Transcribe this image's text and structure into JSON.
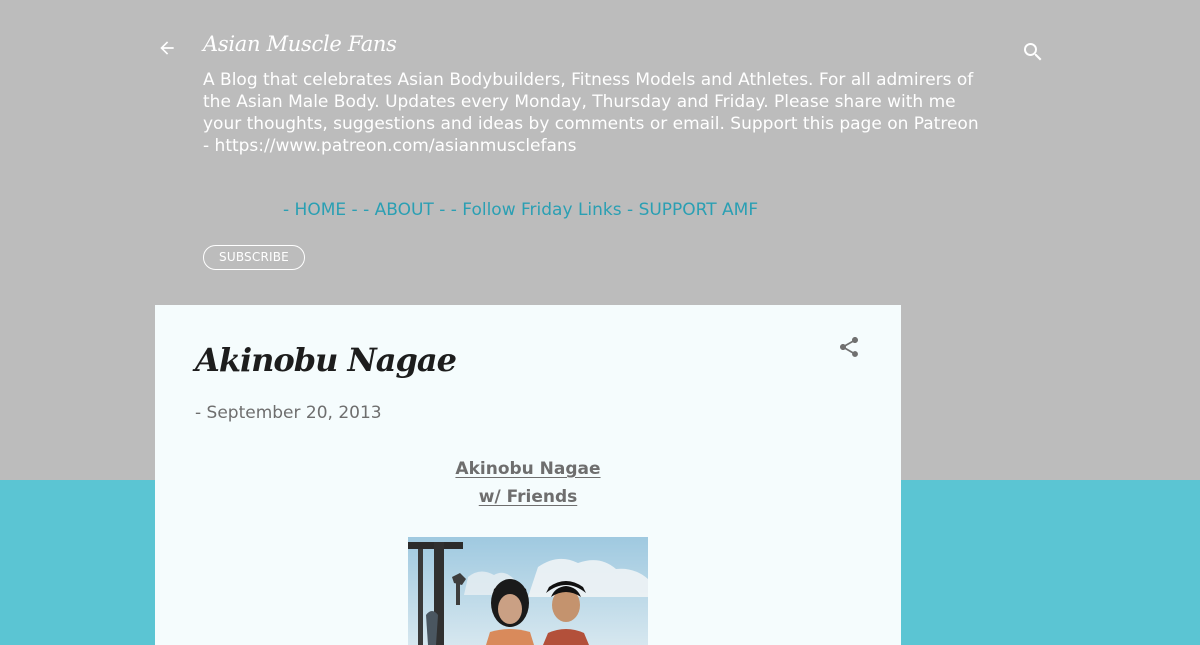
{
  "header": {
    "blog_title": "Asian Muscle Fans",
    "description": "A Blog that celebrates Asian Bodybuilders, Fitness Models and Athletes. For all admirers of the Asian Male Body. Updates every Monday, Thursday and Friday. Please share with me your thoughts, suggestions and ideas by comments or email. Support this page on Patreon - https://www.patreon.com/asianmusclefans",
    "nav": {
      "home": "- HOME -",
      "separator_1": " ",
      "about": "- ABOUT -",
      "separator_2": " ",
      "follow_friday": "- Follow Friday Links -",
      "separator_3": " ",
      "support": "SUPPORT AMF"
    },
    "subscribe_label": "SUBSCRIBE",
    "icons": {
      "back": "arrow-left-icon",
      "search": "search-icon"
    }
  },
  "post": {
    "title": "Akinobu Nagae",
    "date": "- September 20, 2013",
    "subtitle_line1": "Akinobu Nagae",
    "subtitle_line2": "w/ Friends",
    "image_alt": "Akinobu Nagae w/ Friends",
    "icons": {
      "share": "share-icon"
    }
  },
  "colors": {
    "header_background": "#bcbcbc",
    "page_accent": "#5bc5d3",
    "link": "#2a9fb3",
    "card_background": "#f5fcfd"
  }
}
